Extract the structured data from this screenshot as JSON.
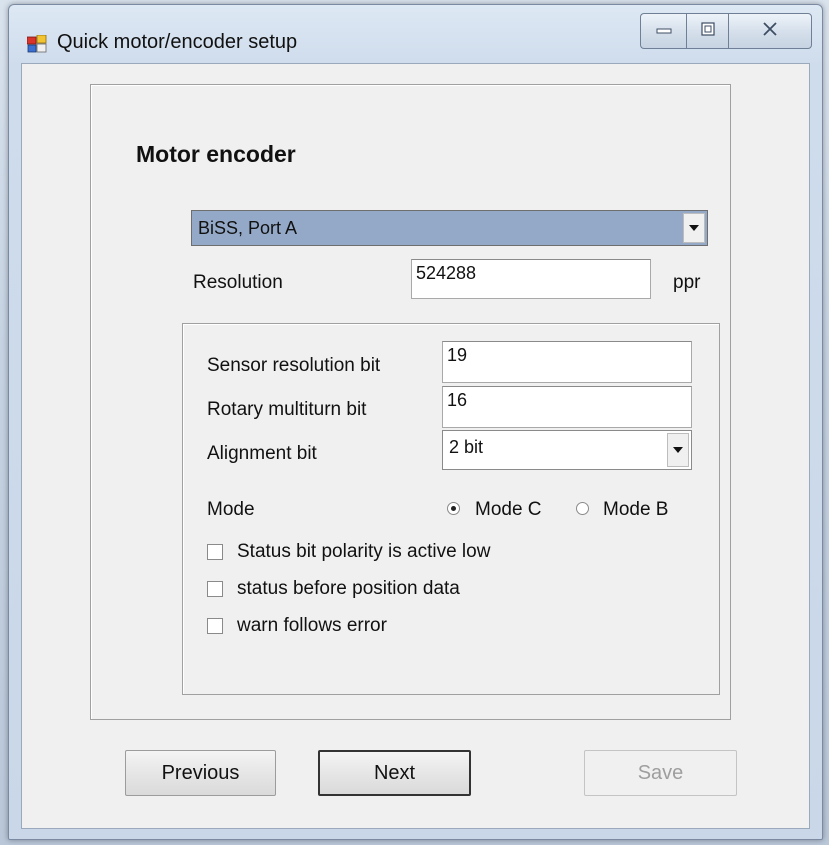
{
  "window": {
    "title": "Quick motor/encoder setup"
  },
  "encoder": {
    "heading": "Motor encoder",
    "type_selected": "BiSS, Port A",
    "resolution_label": "Resolution",
    "resolution_value": "524288",
    "resolution_unit": "ppr"
  },
  "biss": {
    "sensor_resolution_label": "Sensor resolution bit",
    "sensor_resolution_value": "19",
    "rotary_multiturn_label": "Rotary multiturn bit",
    "rotary_multiturn_value": "16",
    "alignment_label": "Alignment bit",
    "alignment_value": "2 bit",
    "mode_label": "Mode",
    "mode_options": [
      "Mode C",
      "Mode B"
    ],
    "mode_selected": "Mode C",
    "checkboxes": [
      {
        "label": "Status bit polarity is active low",
        "checked": false
      },
      {
        "label": "status before position data",
        "checked": false
      },
      {
        "label": "warn follows error",
        "checked": false
      }
    ]
  },
  "buttons": {
    "previous": "Previous",
    "next": "Next",
    "save": "Save"
  },
  "icons": {
    "app": "app-window-icon",
    "minimize": "minimize-icon",
    "maximize": "maximize-icon",
    "close": "close-icon"
  },
  "colors": {
    "selected_dropdown_bg": "#94a9c8",
    "window_frame": "#cfdcec"
  }
}
